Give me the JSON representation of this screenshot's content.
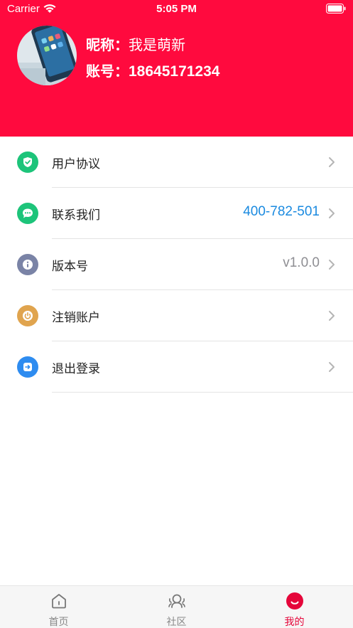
{
  "status_bar": {
    "carrier": "Carrier",
    "time": "5:05 PM"
  },
  "profile": {
    "nickname_label": "昵称：",
    "nickname": "我是萌新",
    "account_label": "账号：",
    "account": "18645171234"
  },
  "menu": {
    "items": [
      {
        "title": "用户协议",
        "value": "",
        "icon": "shield-check-icon",
        "color": "#1dc47a"
      },
      {
        "title": "联系我们",
        "value": "400-782-501",
        "icon": "chat-bubble-icon",
        "color": "#1dc47a",
        "value_color": "#1a8ae0"
      },
      {
        "title": "版本号",
        "value": "v1.0.0",
        "icon": "info-icon",
        "color": "#7a83a6",
        "value_color": "#8e8e93"
      },
      {
        "title": "注销账户",
        "value": "",
        "icon": "power-icon",
        "color": "#e0a44e"
      },
      {
        "title": "退出登录",
        "value": "",
        "icon": "logout-icon",
        "color": "#2e8cf0"
      }
    ]
  },
  "tabbar": {
    "tabs": [
      {
        "label": "首页",
        "icon": "home-icon",
        "active": false
      },
      {
        "label": "社区",
        "icon": "community-icon",
        "active": false
      },
      {
        "label": "我的",
        "icon": "profile-smile-icon",
        "active": true
      }
    ]
  },
  "colors": {
    "header_bg": "#ff0a3e",
    "active_tab": "#e5063a"
  }
}
